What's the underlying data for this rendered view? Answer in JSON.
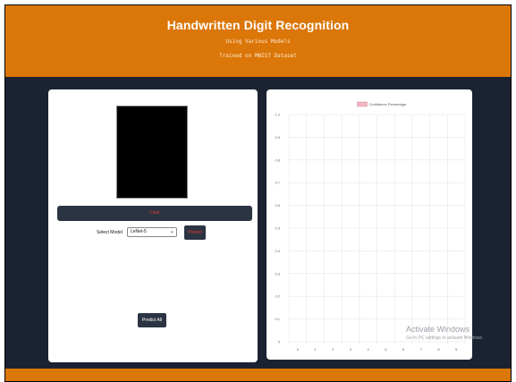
{
  "header": {
    "title": "Handwritten Digit Recognition",
    "subtitle_1": "Using Various Models",
    "subtitle_2": "Trained on MNIST Dataset",
    "background": "#db7608"
  },
  "left_panel": {
    "clear_label": "Clear",
    "model_label": "Select Model",
    "model_selected": "LeNet-5",
    "predict_label": "Predict",
    "predict_all_label": "Predict All"
  },
  "chart_data": {
    "type": "bar",
    "series": [
      {
        "name": "Confidence Percentage",
        "values": [],
        "color": "#f4b6c2"
      }
    ],
    "categories": [
      "0",
      "1",
      "2",
      "3",
      "4",
      "5",
      "6",
      "7",
      "8",
      "9"
    ],
    "yticks": [
      "0",
      "0.1",
      "0.2",
      "0.3",
      "0.4",
      "0.5",
      "0.6",
      "0.7",
      "0.8",
      "0.9",
      "1.0"
    ],
    "ylim": [
      0,
      1.0
    ],
    "grid": true,
    "legend": "top"
  },
  "watermark": {
    "title": "Activate Windows",
    "subtitle": "Go to PC settings to activate Windows."
  },
  "colors": {
    "frame_background": "#1b2232",
    "button_background": "#2b3442",
    "button_accent_text": "#e53935"
  }
}
